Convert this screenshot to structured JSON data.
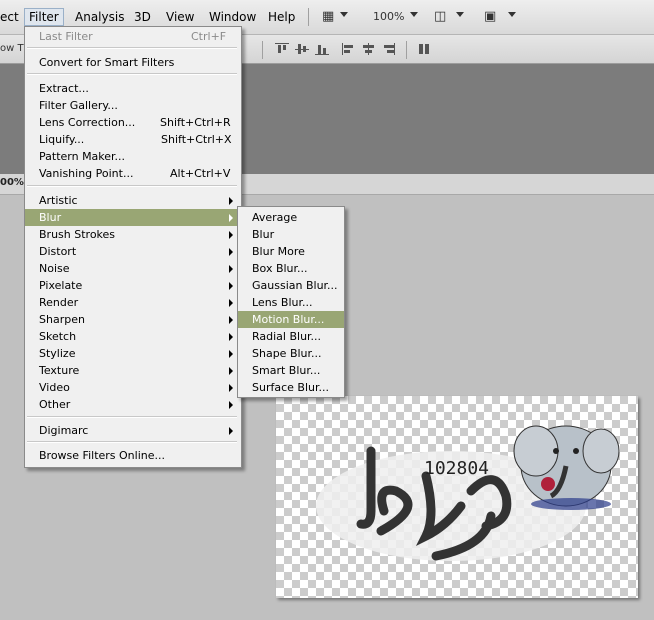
{
  "menubar": {
    "items": [
      "ect",
      "Filter",
      "Analysis",
      "3D",
      "View",
      "Window",
      "Help"
    ],
    "zoom": "100%"
  },
  "options_bar": {
    "left_text": "ow T"
  },
  "document": {
    "zoom_text": "00%"
  },
  "filter_menu": {
    "last_filter": {
      "label": "Last Filter",
      "shortcut": "Ctrl+F"
    },
    "convert": "Convert for Smart Filters",
    "group1": [
      {
        "label": "Extract...",
        "shortcut": ""
      },
      {
        "label": "Filter Gallery...",
        "shortcut": ""
      },
      {
        "label": "Lens Correction...",
        "shortcut": "Shift+Ctrl+R"
      },
      {
        "label": "Liquify...",
        "shortcut": "Shift+Ctrl+X"
      },
      {
        "label": "Pattern Maker...",
        "shortcut": ""
      },
      {
        "label": "Vanishing Point...",
        "shortcut": "Alt+Ctrl+V"
      }
    ],
    "submenus": [
      "Artistic",
      "Blur",
      "Brush Strokes",
      "Distort",
      "Noise",
      "Pixelate",
      "Render",
      "Sharpen",
      "Sketch",
      "Stylize",
      "Texture",
      "Video",
      "Other"
    ],
    "digimarc": "Digimarc",
    "browse": "Browse Filters Online..."
  },
  "blur_menu": {
    "items": [
      "Average",
      "Blur",
      "Blur More",
      "Box Blur...",
      "Gaussian Blur...",
      "Lens Blur...",
      "Motion Blur...",
      "Radial Blur...",
      "Shape Blur...",
      "Smart Blur...",
      "Surface Blur..."
    ]
  },
  "artwork": {
    "number": "102804"
  },
  "colors": {
    "highlight": "#99a674",
    "panel": "#7c7c7c",
    "workspace": "#c0c0c0"
  }
}
